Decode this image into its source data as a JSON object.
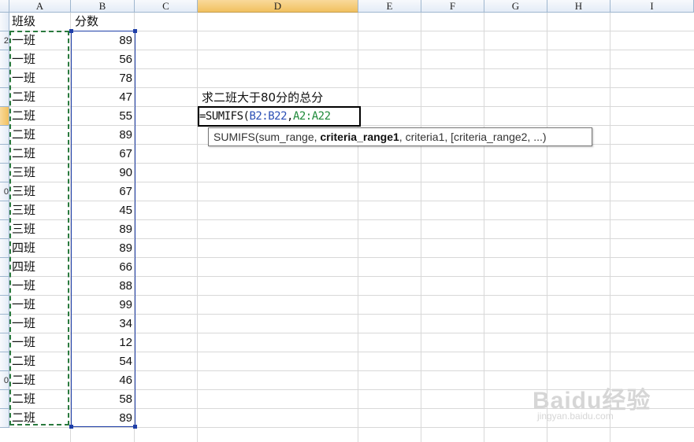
{
  "columns": [
    "A",
    "B",
    "C",
    "D",
    "E",
    "F",
    "G",
    "H",
    "I"
  ],
  "selected_column": "D",
  "header_row": {
    "a": "班级",
    "b": "分数"
  },
  "rows": [
    {
      "a": "一班",
      "b": "89"
    },
    {
      "a": "一班",
      "b": "56"
    },
    {
      "a": "一班",
      "b": "78"
    },
    {
      "a": "二班",
      "b": "47"
    },
    {
      "a": "二班",
      "b": "55"
    },
    {
      "a": "二班",
      "b": "89"
    },
    {
      "a": "二班",
      "b": "67"
    },
    {
      "a": "三班",
      "b": "90"
    },
    {
      "a": "三班",
      "b": "67"
    },
    {
      "a": "三班",
      "b": "45"
    },
    {
      "a": "三班",
      "b": "89"
    },
    {
      "a": "四班",
      "b": "89"
    },
    {
      "a": "四班",
      "b": "66"
    },
    {
      "a": "一班",
      "b": "88"
    },
    {
      "a": "一班",
      "b": "99"
    },
    {
      "a": "一班",
      "b": "34"
    },
    {
      "a": "一班",
      "b": "12"
    },
    {
      "a": "二班",
      "b": "54"
    },
    {
      "a": "二班",
      "b": "46"
    },
    {
      "a": "二班",
      "b": "58"
    },
    {
      "a": "二班",
      "b": "89"
    }
  ],
  "row_header_labels": [
    "",
    "2",
    "",
    "",
    "",
    "",
    "",
    "",
    "",
    "0",
    "",
    "",
    "",
    "",
    "",
    "",
    "",
    "",
    "",
    "0",
    "",
    ""
  ],
  "note": "求二班大于80分的总分",
  "formula": {
    "prefix": "=SUMIFS(",
    "ref1": "B2:B22",
    "sep": ",",
    "ref2": "A2:A22"
  },
  "tooltip": {
    "func": "SUMIFS(",
    "arg1": "sum_range, ",
    "arg_current": "criteria_range1",
    "rest": ", criteria1, [criteria_range2, ...)"
  },
  "watermark": {
    "logo": "Baidu经验",
    "url": "jingyan.baidu.com"
  }
}
